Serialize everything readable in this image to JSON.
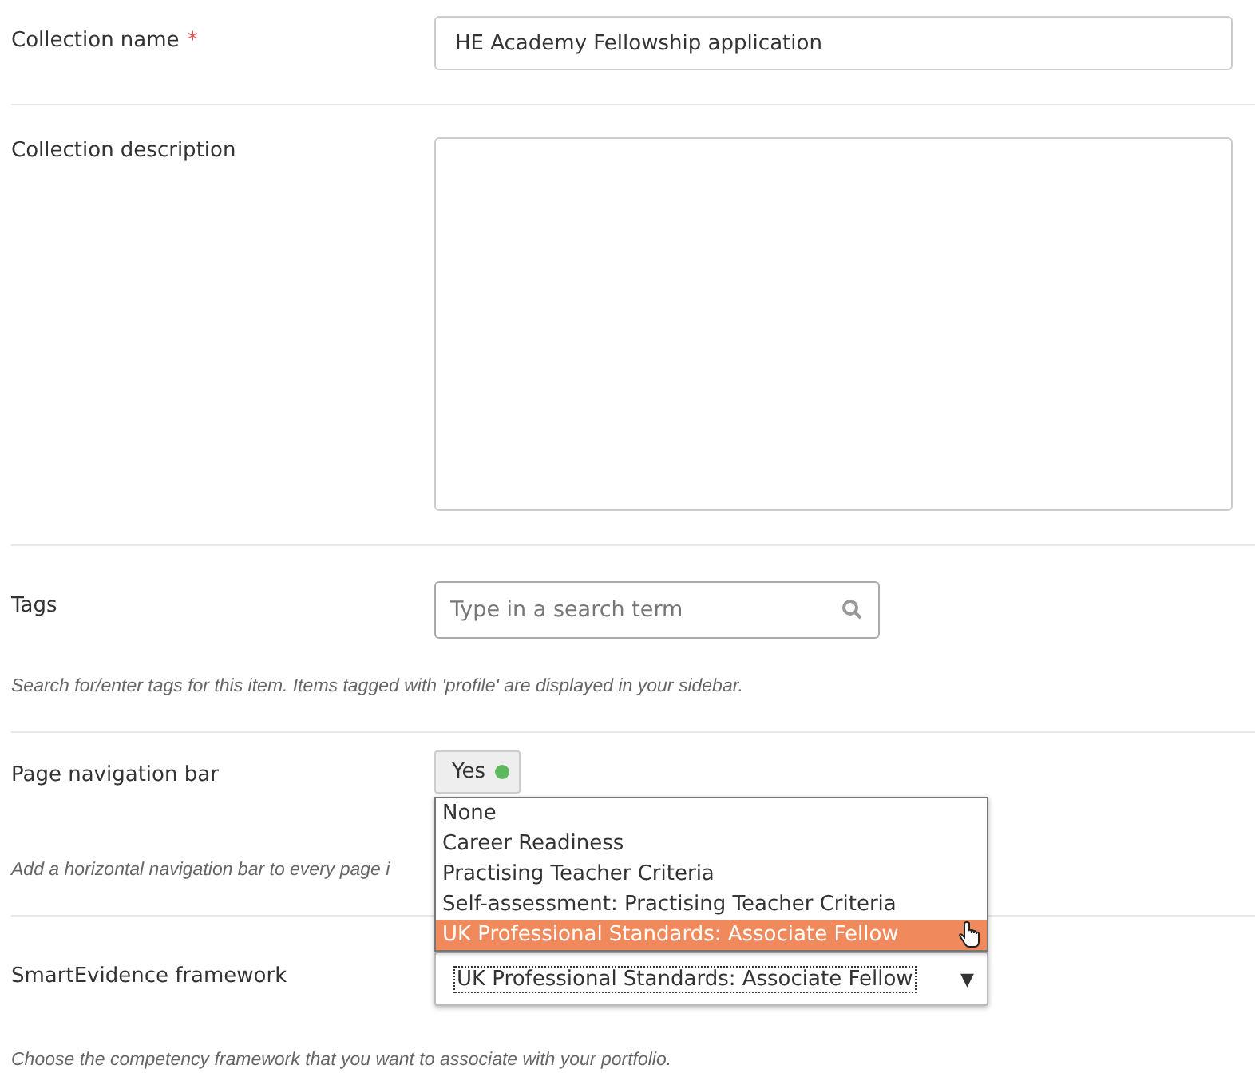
{
  "fields": [
    {
      "kind": "text",
      "label": "Collection name",
      "required_mark": "*",
      "value": "HE Academy Fellowship application"
    },
    {
      "kind": "textarea",
      "label": "Collection description"
    },
    {
      "kind": "tags",
      "label": "Tags",
      "placeholder": "Type in a search term",
      "help": "Search for/enter tags for this item. Items tagged with 'profile' are displayed in your sidebar."
    },
    {
      "kind": "switch",
      "label": "Page navigation bar",
      "on": true,
      "switch_label": "Yes",
      "help": "Add a horizontal navigation bar to every page i"
    },
    {
      "kind": "select",
      "label": "SmartEvidence framework",
      "value": "UK Professional Standards: Associate Fellow",
      "arrow": "▼",
      "expanded": true,
      "options": [
        {
          "label": "None",
          "selected": false
        },
        {
          "label": "Career Readiness",
          "selected": false
        },
        {
          "label": "Practising Teacher Criteria",
          "selected": false
        },
        {
          "label": "Self-assessment: Practising Teacher Criteria",
          "selected": false
        },
        {
          "label": "UK Professional Standards: Associate Fellow",
          "selected": true
        }
      ],
      "help": "Choose the competency framework that you want to associate with your portfolio."
    }
  ]
}
